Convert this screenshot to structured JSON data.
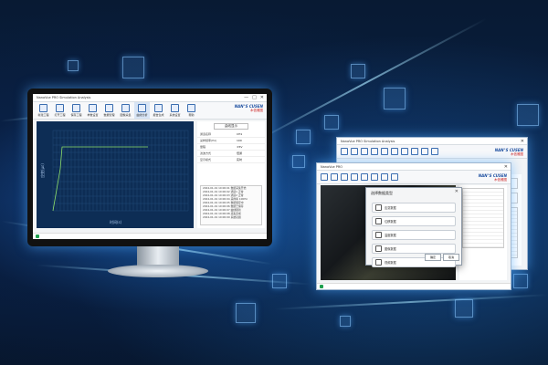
{
  "main_window": {
    "title_text": "NanoVue  PRO  Simulation Analysis",
    "controls": [
      "—",
      "□",
      "✕"
    ],
    "toolbar": [
      {
        "icon": "file-icon",
        "label": "新建工程"
      },
      {
        "icon": "folder-icon",
        "label": "打开工程"
      },
      {
        "icon": "save-icon",
        "label": "保存工程"
      },
      {
        "icon": "edit-icon",
        "label": "参数设置"
      },
      {
        "icon": "grid-icon",
        "label": "数据管理"
      },
      {
        "icon": "image-icon",
        "label": "图像采集"
      },
      {
        "icon": "chart-icon",
        "label": "曲线分析"
      },
      {
        "icon": "report-icon",
        "label": "报告生成"
      },
      {
        "icon": "gear-icon",
        "label": "系统设置"
      },
      {
        "icon": "help-icon",
        "label": "帮助"
      }
    ],
    "brand_line1": "NAN°S CUSEN",
    "brand_line2": "木信雅图",
    "chart_ylabel": "应变(με)",
    "chart_xlabel": "时间(s)",
    "right_tab": "曲线显示",
    "props": [
      {
        "k": "通道名称",
        "v": "CH1"
      },
      {
        "k": "采样频率(Hz)",
        "v": "100"
      },
      {
        "k": "量程",
        "v": "±5V"
      },
      {
        "k": "滤波方式",
        "v": "低通"
      },
      {
        "k": "显示模式",
        "v": "实时"
      }
    ],
    "log_lines": [
      "2024-01-01 10:00:01  数据采集开始",
      "2024-01-01 10:00:02  通道1 正常",
      "2024-01-01 10:00:03  通道2 正常",
      "2024-01-01 10:00:04  采样率 100Hz",
      "2024-01-01 10:00:05  数据保存中",
      "2024-01-01 10:00:06  数据已保存",
      "2024-01-01 10:00:07  曲线刷新",
      "2024-01-01 10:00:08  采集完成",
      "2024-01-01 10:00:09  系统就绪"
    ]
  },
  "back_window": {
    "title_text": "NanoVue  PRO  Simulation Analysis",
    "brand_line1": "NAN°S CUSEN",
    "brand_line2": "木信雅图"
  },
  "front_window": {
    "title_text": "NanoVue PRO",
    "brand_line1": "NAN°S CUSEN",
    "brand_line2": "木信雅图",
    "dialog": {
      "title": "选择数据类型",
      "items": [
        "应变数据",
        "位移数据",
        "温度数据",
        "图像数据",
        "视频数据"
      ],
      "ok_label": "确定",
      "cancel_label": "取消"
    }
  },
  "colors": {
    "accent": "#3a6db0",
    "chart_bg": "#0d2d55",
    "series": "#8fe06a",
    "status_ok": "#1fa04f"
  }
}
